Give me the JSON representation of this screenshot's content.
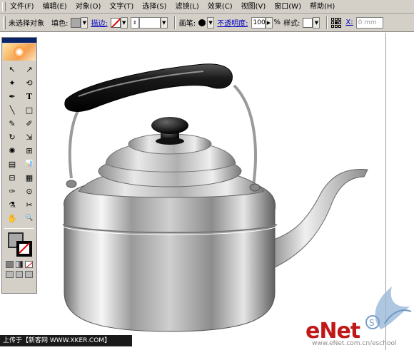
{
  "menubar": {
    "items": [
      "文件(F)",
      "编辑(E)",
      "对象(O)",
      "文字(T)",
      "选择(S)",
      "滤镜(L)",
      "效果(C)",
      "视图(V)",
      "窗口(W)",
      "帮助(H)"
    ]
  },
  "controlbar": {
    "selection_status": "未选择对象",
    "fill_label": "填色:",
    "stroke_label": "描边:",
    "brush_label": "画笔:",
    "opacity_label": "不透明度:",
    "opacity_value": "100",
    "percent": "%",
    "style_label": "样式:",
    "x_label": "X:",
    "x_value": "0 mm"
  },
  "tools_panel": {
    "rows": [
      [
        "↖",
        "↗"
      ],
      [
        "✦",
        "⟲"
      ],
      [
        "✒",
        "T"
      ],
      [
        "╲",
        "□"
      ],
      [
        "✎",
        "✐"
      ],
      [
        "↻",
        "⇲"
      ],
      [
        "✺",
        "⊞"
      ],
      [
        "▤",
        "📊"
      ],
      [
        "⊟",
        "▦"
      ],
      [
        "✑",
        "⊙"
      ],
      [
        "⚗",
        "✂"
      ],
      [
        "✋",
        "🔍"
      ]
    ]
  },
  "watermarks": {
    "footer_text": "上传于【新客网 WWW.XKER.COM】",
    "brand": "eNet",
    "url": "www.eNet.com.cn/eschool"
  },
  "colors": {
    "chrome": "#d4d0c8",
    "footer_bg": "#1a1a1a",
    "brand_red": "#c01818",
    "link_blue": "#0000c0"
  }
}
